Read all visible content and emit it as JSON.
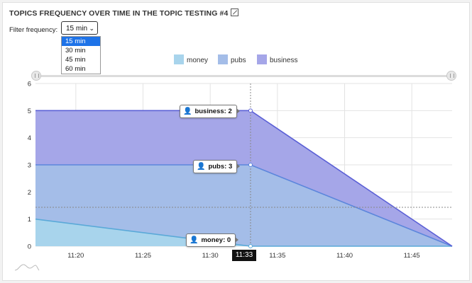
{
  "header": {
    "title": "TOPICS FREQUENCY OVER TIME IN THE TOPIC TESTING #4",
    "icon": "external-link-icon"
  },
  "filter": {
    "label": "Filter frequency:",
    "selected": "15 min",
    "options": [
      "15 min",
      "30 min",
      "45 min",
      "60 min"
    ]
  },
  "colors": {
    "money": "#a8d4ec",
    "pubs": "#a4bde8",
    "business": "#a5a6e8"
  },
  "chart_data": {
    "type": "area",
    "stacked": true,
    "x": [
      "11:17",
      "11:33",
      "11:48"
    ],
    "x_ticks": [
      "11:20",
      "11:25",
      "11:30",
      "11:35",
      "11:40",
      "11:45"
    ],
    "y_ticks": [
      "0",
      "1",
      "2",
      "3",
      "4",
      "5",
      "6"
    ],
    "ylim": [
      0,
      6
    ],
    "series": [
      {
        "name": "money",
        "values": [
          1,
          0,
          0
        ]
      },
      {
        "name": "pubs",
        "values": [
          2,
          3,
          0
        ]
      },
      {
        "name": "business",
        "values": [
          2,
          2,
          0
        ]
      }
    ],
    "legend_position": "top",
    "grid": true,
    "cursor": {
      "time": "11:33",
      "labels": [
        {
          "series": "business",
          "text": "business: 2"
        },
        {
          "series": "pubs",
          "text": "pubs: 3"
        },
        {
          "series": "money",
          "text": "money: 0"
        }
      ]
    }
  }
}
